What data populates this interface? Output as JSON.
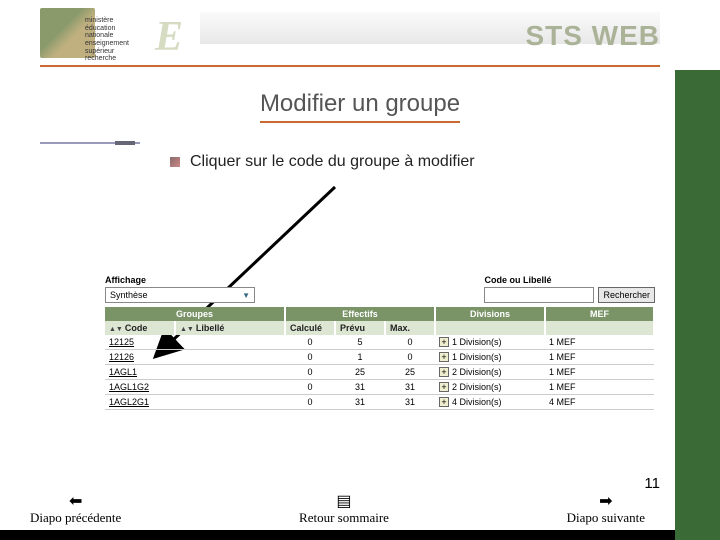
{
  "header": {
    "ministry_text": "ministère\néducation\nnationale\nenseignement\nsupérieur\nrecherche",
    "brand": "STS WEB"
  },
  "title": "Modifier un groupe",
  "bullet": "Cliquer sur le code du groupe à modifier",
  "screenshot": {
    "affichage_label": "Affichage",
    "affichage_value": "Synthèse",
    "search_label": "Code ou Libellé",
    "search_button": "Rechercher",
    "section_headers": {
      "groupes": "Groupes",
      "effectifs": "Effectifs",
      "divisions": "Divisions",
      "mef": "MEF"
    },
    "columns": {
      "code": "Code",
      "libelle": "Libellé",
      "calcule": "Calculé",
      "prevu": "Prévu",
      "max": "Max."
    },
    "rows": [
      {
        "code": "12125",
        "libelle": "",
        "calcule": "0",
        "prevu": "5",
        "max": "0",
        "divisions": "1 Division(s)",
        "mef": "1 MEF"
      },
      {
        "code": "12126",
        "libelle": "",
        "calcule": "0",
        "prevu": "1",
        "max": "0",
        "divisions": "1 Division(s)",
        "mef": "1 MEF"
      },
      {
        "code": "1AGL1",
        "libelle": "",
        "calcule": "0",
        "prevu": "25",
        "max": "25",
        "divisions": "2 Division(s)",
        "mef": "1 MEF"
      },
      {
        "code": "1AGL1G2",
        "libelle": "",
        "calcule": "0",
        "prevu": "31",
        "max": "31",
        "divisions": "2 Division(s)",
        "mef": "1 MEF"
      },
      {
        "code": "1AGL2G1",
        "libelle": "",
        "calcule": "0",
        "prevu": "31",
        "max": "31",
        "divisions": "4 Division(s)",
        "mef": "4 MEF"
      }
    ]
  },
  "footer": {
    "prev": "Diapo précédente",
    "home": "Retour sommaire",
    "next": "Diapo suivante",
    "page_number": "11"
  }
}
